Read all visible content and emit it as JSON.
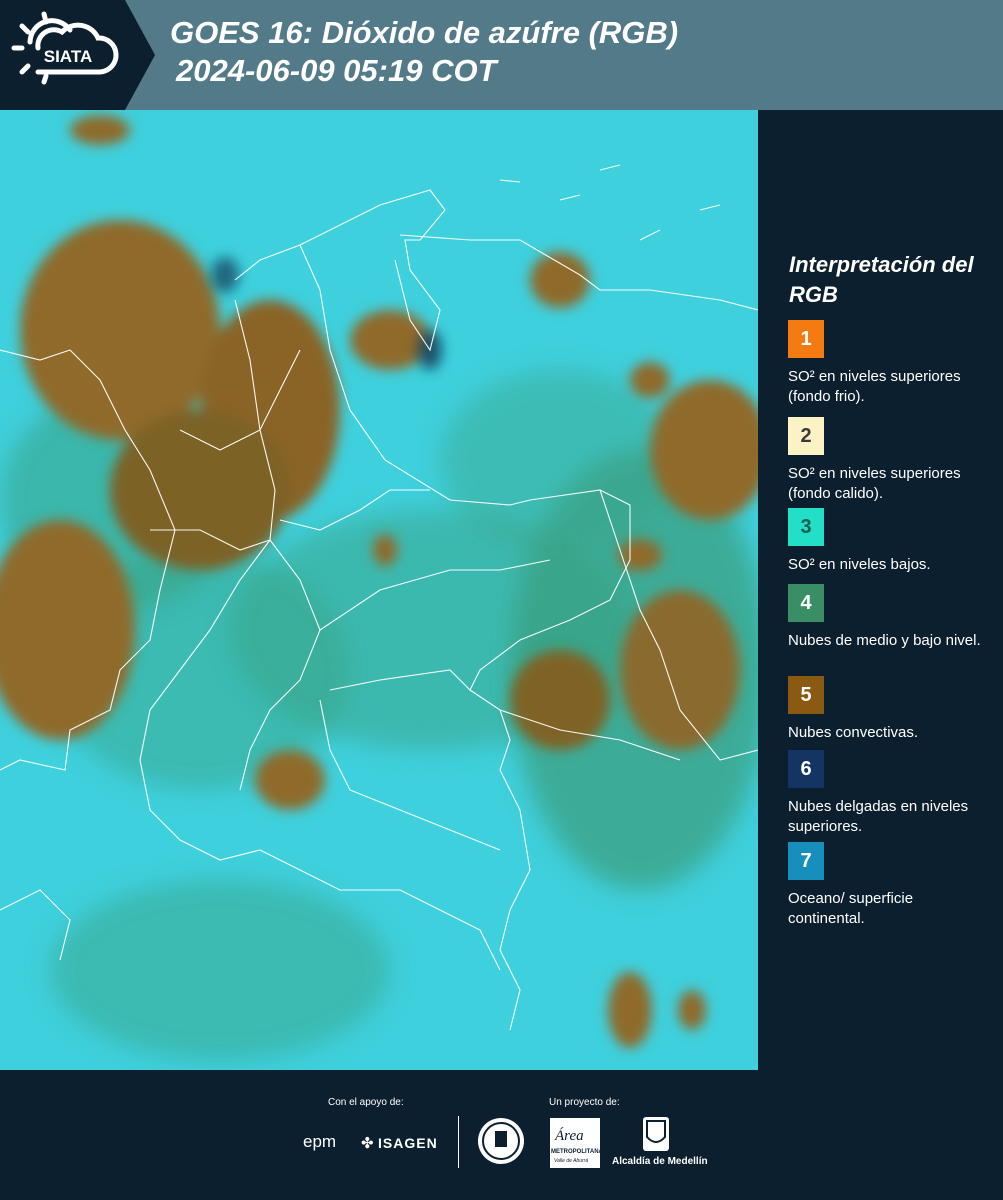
{
  "header": {
    "logo_text": "SIATA",
    "title": "GOES 16: Dióxido de azúfre (RGB)",
    "subtitle": "2024-06-09 05:19 COT"
  },
  "legend": {
    "title": "Interpretación del RGB",
    "items": [
      {
        "number": "1",
        "label": "SO² en niveles superiores (fondo frio).",
        "color": "#f47b12",
        "text_color": "#ffffff"
      },
      {
        "number": "2",
        "label": "SO² en niveles superiores (fondo calido).",
        "color": "#fbf3c4",
        "text_color": "#3a3a3a"
      },
      {
        "number": "3",
        "label": "SO² en niveles bajos.",
        "color": "#22e0c7",
        "text_color": "#1e5b55"
      },
      {
        "number": "4",
        "label": "Nubes de medio y bajo nivel.",
        "color": "#3a8e66",
        "text_color": "#ffffff"
      },
      {
        "number": "5",
        "label": "Nubes convectivas.",
        "color": "#8a5a12",
        "text_color": "#ffffff"
      },
      {
        "number": "6",
        "label": "Nubes delgadas en niveles superiores.",
        "color": "#143564",
        "text_color": "#ffffff"
      },
      {
        "number": "7",
        "label": "Oceano/ superficie continental.",
        "color": "#178fbd",
        "text_color": "#ffffff"
      }
    ]
  },
  "footer": {
    "support_label": "Con el apoyo de:",
    "project_label": "Un proyecto de:",
    "sponsors": {
      "epm": "epm",
      "isagen": "ISAGEN",
      "metropolitana": "METROPOLITANA",
      "area": "Área",
      "valle": "Valle de Aburrá",
      "alcaldia": "Alcaldía de Medellín",
      "medellin_seal": "MEDELLÍN"
    }
  },
  "colors": {
    "background": "#0c1f2e",
    "header": "#527a89",
    "sea": "#3fd0dd",
    "cloud_convective": "#8f6a2a",
    "cloud_low": "#3a9d7a",
    "borders": "#ffffff"
  },
  "icons": {
    "logo": "sun-cloud-icon"
  }
}
